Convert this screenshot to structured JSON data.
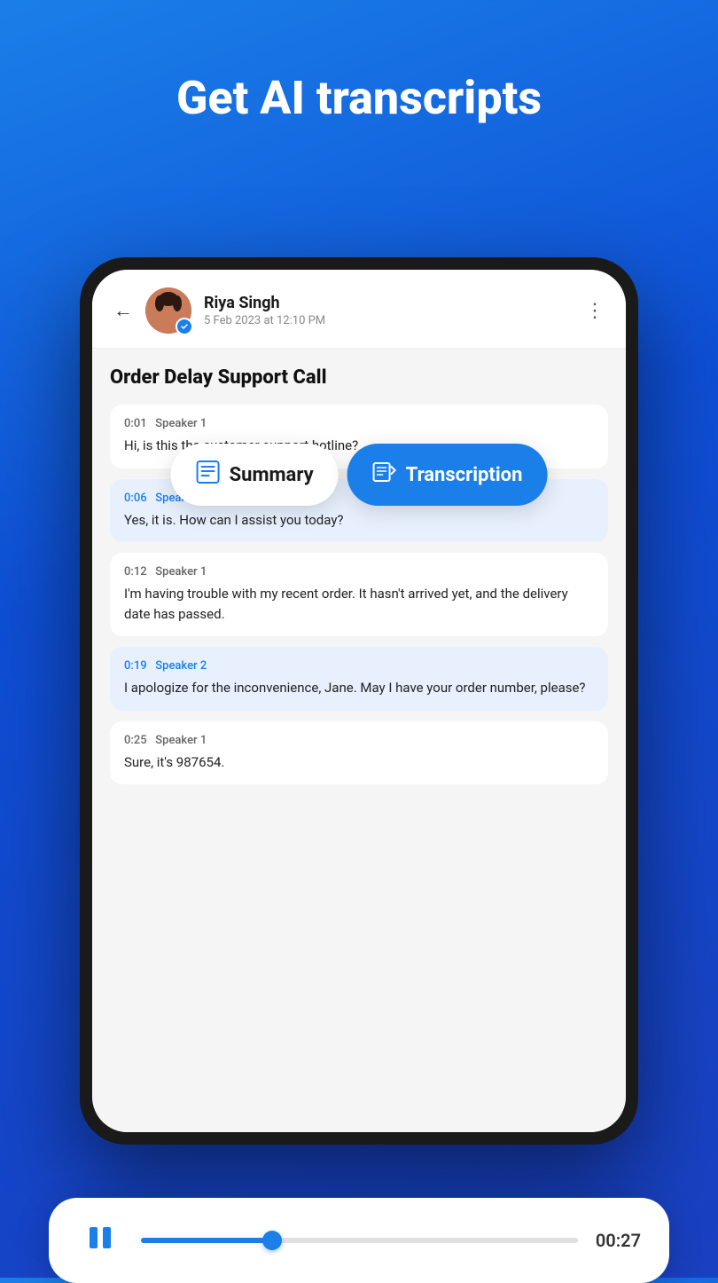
{
  "hero": {
    "title": "Get AI transcripts"
  },
  "header": {
    "caller_name": "Riya Singh",
    "call_date": "5 Feb 2023 at 12:10 PM",
    "more_icon": "⋮",
    "back_icon": "←"
  },
  "tabs": {
    "summary_label": "Summary",
    "transcription_label": "Transcription"
  },
  "call": {
    "title": "Order Delay Support Call"
  },
  "transcript": [
    {
      "time": "0:01",
      "speaker": "Speaker 1",
      "text": "Hi, is this the customer support hotline?",
      "type": "speaker1"
    },
    {
      "time": "0:06",
      "speaker": "Speaker 2",
      "text": "Yes, it is. How can I assist you today?",
      "type": "speaker2"
    },
    {
      "time": "0:12",
      "speaker": "Speaker 1",
      "text": "I'm having trouble with my recent order. It hasn't arrived yet, and the delivery date has passed.",
      "type": "speaker1"
    },
    {
      "time": "0:19",
      "speaker": "Speaker 2",
      "text": "I apologize for the inconvenience, Jane. May I have your order number, please?",
      "type": "speaker2"
    },
    {
      "time": "0:25",
      "speaker": "Speaker 1",
      "text": "Sure, it's 987654.",
      "type": "speaker1"
    }
  ],
  "player": {
    "time_display": "00:27",
    "progress_percent": 30
  }
}
